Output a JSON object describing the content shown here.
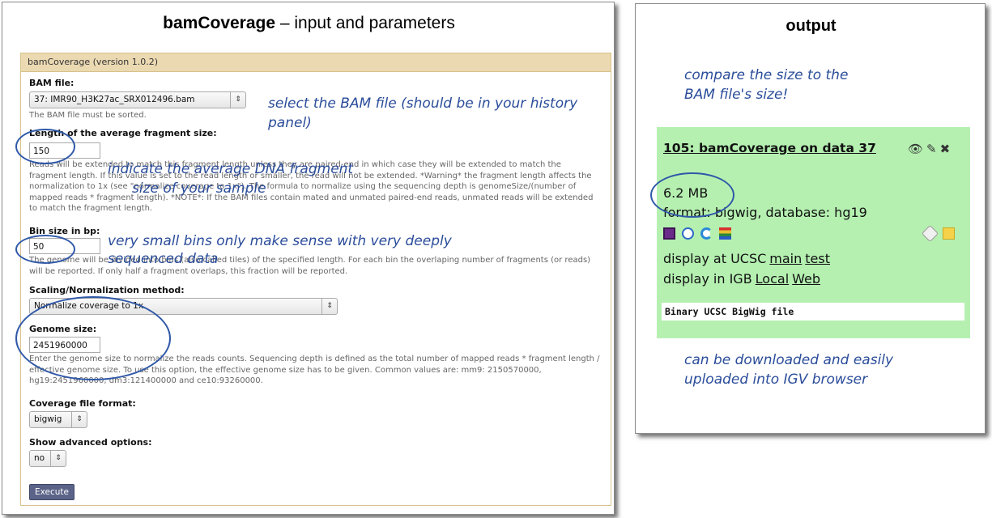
{
  "left": {
    "title_bold": "bamCoverage",
    "title_rest": " – input and parameters"
  },
  "form": {
    "header": "bamCoverage (version 1.0.2)",
    "bam_label": "BAM file:",
    "bam_value": "37: IMR90_H3K27ac_SRX012496.bam",
    "bam_help": "The BAM file must be sorted.",
    "frag_label": "Length of the average fragment size:",
    "frag_value": "150",
    "frag_help": "Reads will be extended to match this fragment length unless they are paired-end in which case they will be extended to match the fragment length. If this value is set to the read length or smaller, the read will not be extended. *Warning* the fragment length affects the normalization to 1x (see \"normalize coverage to 1x\"). The formula to normalize using the sequencing depth is genomeSize/(number of mapped reads * fragment length). *NOTE*: If the BAM files contain mated and unmated paired-end reads, unmated reads will be extended to match the fragment length.",
    "bin_label": "Bin size in bp:",
    "bin_value": "50",
    "bin_help": "The genome will be divided into bins (also called tiles) of the specified length. For each bin the overlaping number of fragments (or reads) will be reported. If only half a fragment overlaps, this fraction will be reported.",
    "scaling_label": "Scaling/Normalization method:",
    "scaling_value": "Normalize coverage to 1x",
    "genome_label": "Genome size:",
    "genome_value": "2451960000",
    "genome_help": "Enter the genome size to normalize the reads counts. Sequencing depth is defined as the total number of mapped reads * fragment length / effective genome size. To use this option, the effective genome size has to be given. Common values are: mm9: 2150570000, hg19:2451960000, dm3:121400000 and ce10:93260000.",
    "format_label": "Coverage file format:",
    "format_value": "bigwig",
    "advanced_label": "Show advanced options:",
    "advanced_value": "no",
    "execute_label": "Execute"
  },
  "annotations": {
    "bam_note": "select the BAM file (should be in your history panel)",
    "frag_note_1": "indicate the average DNA fragment",
    "frag_note_2": "size of your sample",
    "bin_note_1": "very small bins only make sense with very deeply",
    "bin_note_2": "sequenced data",
    "size_note_1": "compare the size to the",
    "size_note_2": "BAM file's size!",
    "download_note_1": "can be downloaded and easily",
    "download_note_2": "uploaded into IGV browser"
  },
  "right": {
    "title": "output",
    "dataset": {
      "title": "105: bamCoverage on data 37",
      "size": "6.2 MB",
      "format_label": "format:",
      "format_value": "bigwig,",
      "database_label": "database:",
      "database_value": "hg19",
      "ucsc_label": "display at UCSC",
      "ucsc_main": "main",
      "ucsc_test": "test",
      "igb_label": "display in IGB",
      "igb_local": "Local",
      "igb_web": "Web",
      "peek": "Binary UCSC BigWig file"
    }
  },
  "colors": {
    "annotation": "#2a4c9a",
    "dataset_bg": "#b5f0b1",
    "form_header_bg": "#ebd9b2",
    "execute_bg": "#5b6488"
  }
}
